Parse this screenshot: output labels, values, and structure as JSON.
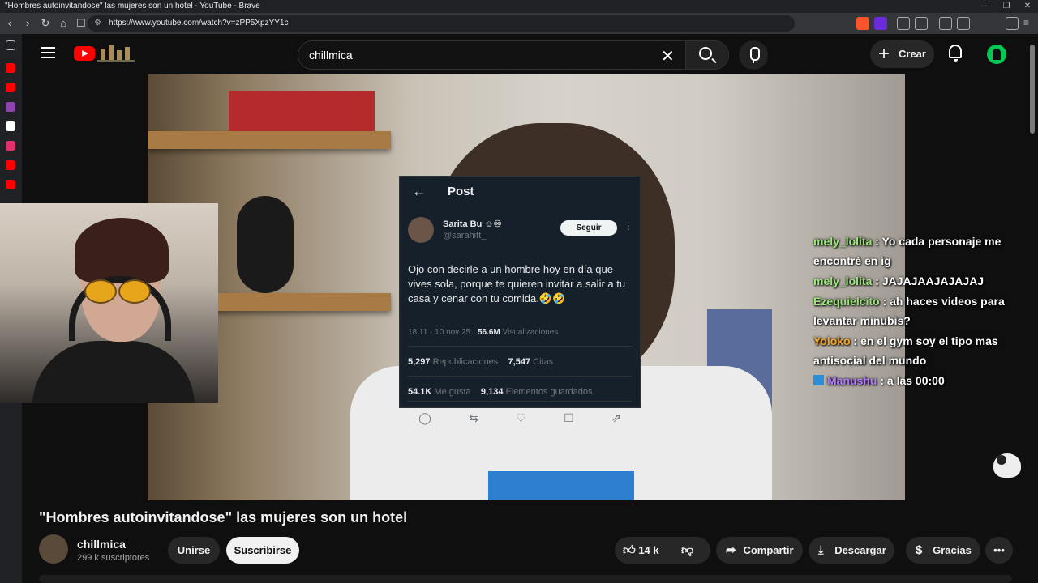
{
  "browser": {
    "window_title": "\"Hombres autoinvitandose\" las mujeres son un hotel - YouTube - Brave",
    "url": "https://www.youtube.com/watch?v=zPP5XpzYY1c"
  },
  "youtube": {
    "search_value": "chillmica",
    "create_label": "Crear"
  },
  "post": {
    "header": "Post",
    "author_name": "Sarita Bu ☺︎♾",
    "author_handle": "@sarahift_",
    "follow_label": "Seguir",
    "text": "Ojo con decirle a un hombre hoy en día que vives sola, porque te quieren invitar a salir a tu casa y cenar con tu comida.🤣🤣",
    "time": "18:11 · 10 nov 25 · ",
    "views": "56.6M",
    "views_label": " Visualizaciones",
    "reposts": "5,297",
    "reposts_label": " Republicaciones",
    "quotes": "7,547",
    "quotes_label": " Citas",
    "likes": "54.1K",
    "likes_label": " Me gusta",
    "bookmarks": "9,134",
    "bookmarks_label": " Elementos guardados"
  },
  "chat": [
    {
      "user": "mely_lolita",
      "color": "#9be87a",
      "message": " : Yo cada personaje me encontré en ig"
    },
    {
      "user": "mely_lolita",
      "color": "#9be87a",
      "message": " : JAJAJAAJAJAJAJ"
    },
    {
      "user": "Ezequielcito",
      "color": "#9be87a",
      "message": " : ah haces videos para levantar minubis?"
    },
    {
      "user": "Yoloko",
      "color": "#f5a623",
      "message": " : en el gym soy el tipo mas antisocial del mundo"
    },
    {
      "user": "Manushu",
      "color": "#b57cff",
      "message": " : a las 00:00"
    }
  ],
  "video": {
    "title": "\"Hombres autoinvitandose\" las mujeres son un hotel",
    "channel": "chillmica",
    "subscribers": "299 k suscriptores",
    "join_label": "Unirse",
    "subscribe_label": "Suscribirse",
    "likes": "14 k",
    "share_label": "Compartir",
    "download_label": "Descargar",
    "thanks_label": "Gracias"
  }
}
